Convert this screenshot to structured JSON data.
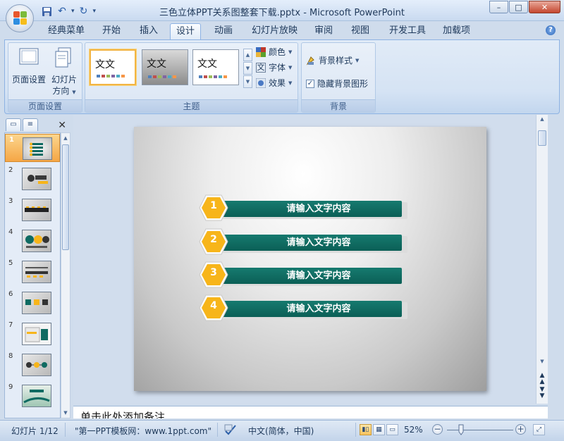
{
  "window": {
    "title": "三色立体PPT关系图整套下载.pptx - Microsoft PowerPoint",
    "controls": [
      "–",
      "□",
      "✕"
    ]
  },
  "qat": [
    "save-icon",
    "undo-icon",
    "redo-icon",
    "customize-icon"
  ],
  "ribbon_tabs": [
    "经典菜单",
    "开始",
    "插入",
    "设计",
    "动画",
    "幻灯片放映",
    "审阅",
    "视图",
    "开发工具",
    "加载项"
  ],
  "active_tab": "设计",
  "ribbon": {
    "page_setup": {
      "label": "页面设置",
      "page_setup_btn": "页面设置",
      "orientation_btn_line1": "幻灯片",
      "orientation_btn_line2": "方向"
    },
    "theme": {
      "label": "主题",
      "thumb_text": "文文",
      "colors": "颜色",
      "fonts": "字体",
      "effects": "效果",
      "font_glyph": "文"
    },
    "background": {
      "label": "背景",
      "styles": "背景样式",
      "hide_graphics": "隐藏背景图形",
      "hide_graphics_checked": true
    }
  },
  "slides_pane": {
    "numbers": [
      "1",
      "2",
      "3",
      "4",
      "5",
      "6",
      "7",
      "8",
      "9"
    ],
    "selected": 1
  },
  "slide": {
    "items": [
      {
        "num": "1",
        "text": "请输入文字内容"
      },
      {
        "num": "2",
        "text": "请输入文字内容"
      },
      {
        "num": "3",
        "text": "请输入文字内容"
      },
      {
        "num": "4",
        "text": "请输入文字内容"
      }
    ],
    "accent_teal": "#0f6b62",
    "hex_yellow": "#f7b51a"
  },
  "notes": {
    "placeholder": "单击此处添加备注"
  },
  "status": {
    "slide_indicator": "幻灯片 1/12",
    "theme_name": "\"第一PPT模板网：www.1ppt.com\"",
    "language": "中文(简体，中国)",
    "zoom": "52%"
  }
}
